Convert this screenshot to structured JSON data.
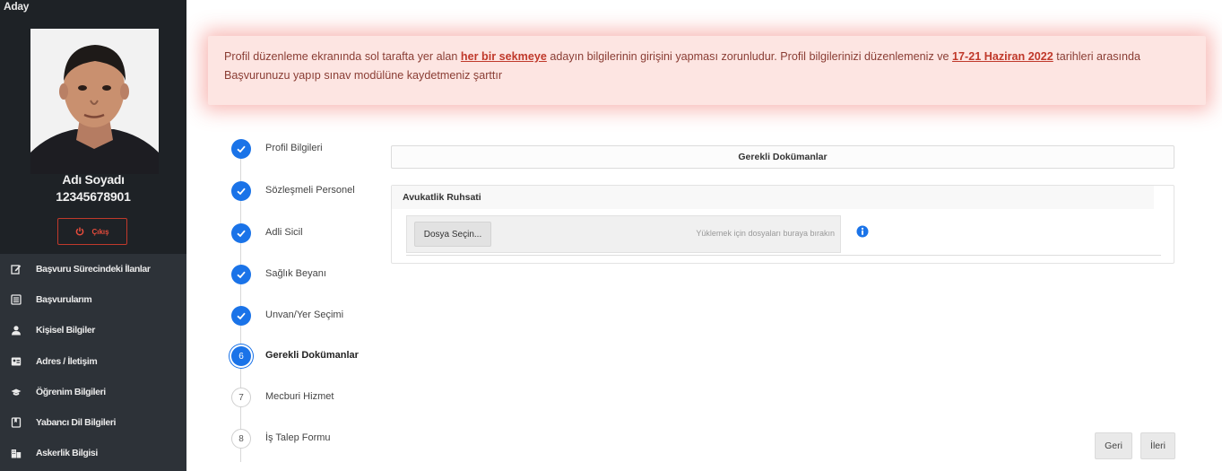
{
  "sidebar": {
    "heading": "Aday",
    "user_name": "Adı Soyadı",
    "user_id": "12345678901",
    "logout_label": "Çıkış",
    "menu": [
      {
        "label": "Başvuru Sürecindeki İlanlar",
        "icon": "edit-icon"
      },
      {
        "label": "Başvurularım",
        "icon": "list-icon"
      },
      {
        "label": "Kişisel Bilgiler",
        "icon": "user-icon"
      },
      {
        "label": "Adres / İletişim",
        "icon": "address-card-icon"
      },
      {
        "label": "Öğrenim Bilgileri",
        "icon": "graduation-cap-icon"
      },
      {
        "label": "Yabancı Dil Bilgileri",
        "icon": "bookmark-icon"
      },
      {
        "label": "Askerlik Bilgisi",
        "icon": "building-icon"
      }
    ]
  },
  "alert": {
    "text_1": "Profil düzenleme ekranında sol tarafta yer alan ",
    "emphasis_1": "her bir sekmeye",
    "text_2": " adayın bilgilerinin girişini yapması zorunludur.  Profil bilgilerinizi düzenlemeniz ve ",
    "emphasis_2": "17-21 Haziran 2022",
    "text_3": " tarihleri arasında Başvurunuzu yapıp sınav modülüne kaydetmeniz şarttır"
  },
  "steps": [
    {
      "number": "1",
      "label": "Profil Bilgileri",
      "state": "done"
    },
    {
      "number": "2",
      "label": "Sözleşmeli Personel",
      "state": "done"
    },
    {
      "number": "3",
      "label": "Adli Sicil",
      "state": "done"
    },
    {
      "number": "4",
      "label": "Sağlık Beyanı",
      "state": "done"
    },
    {
      "number": "5",
      "label": "Unvan/Yer Seçimi",
      "state": "done"
    },
    {
      "number": "6",
      "label": "Gerekli Dokümanlar",
      "state": "active"
    },
    {
      "number": "7",
      "label": "Mecburi Hizmet",
      "state": "todo"
    },
    {
      "number": "8",
      "label": "İş Talep Formu",
      "state": "todo"
    }
  ],
  "documents": {
    "header": "Gerekli Dokümanlar",
    "card_title": "Avukatlik Ruhsati",
    "file_button": "Dosya Seçin...",
    "drop_hint": "Yüklemek için dosyaları buraya bırakın",
    "info_icon": "info-circle-icon"
  },
  "nav": {
    "back_label": "Geri",
    "next_label": "İleri"
  },
  "colors": {
    "sidebar_bg": "#2d3238",
    "accent_blue": "#1a73e8",
    "alert_bg": "#fde5e2",
    "alert_emphasis": "#c0392b"
  }
}
